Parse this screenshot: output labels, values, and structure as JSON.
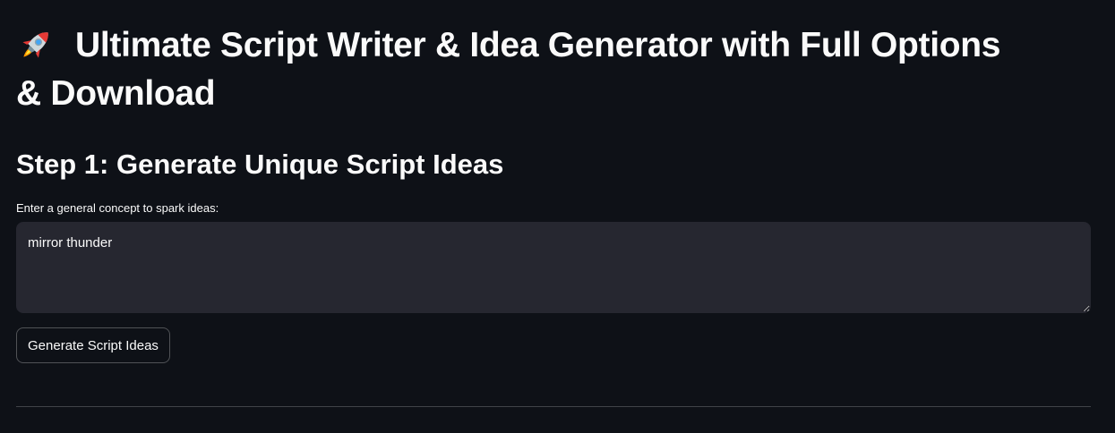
{
  "header": {
    "title_line1": "Ultimate Script Writer & Idea Generator with Full Options",
    "title_line2": "& Download",
    "icon": "rocket-icon"
  },
  "step1": {
    "heading": "Step 1: Generate Unique Script Ideas",
    "concept_label": "Enter a general concept to spark ideas:",
    "concept_value": "mirror thunder",
    "button_label": "Generate Script Ideas"
  },
  "colors": {
    "background": "#0e1117",
    "input_background": "#262730",
    "text": "#fafafa"
  }
}
